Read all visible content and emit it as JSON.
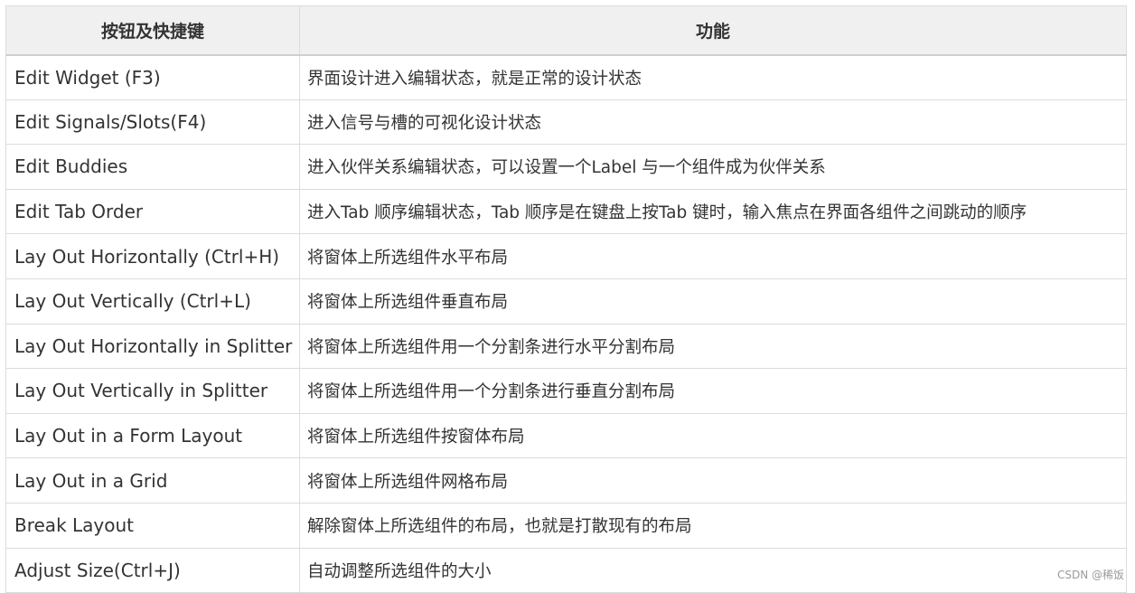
{
  "table": {
    "headers": [
      "按钮及快捷键",
      "功能"
    ],
    "rows": [
      {
        "key": "Edit Widget (F3)",
        "function": "界面设计进入编辑状态，就是正常的设计状态"
      },
      {
        "key": "Edit Signals/Slots(F4)",
        "function": "进入信号与槽的可视化设计状态"
      },
      {
        "key": "Edit Buddies",
        "function": "进入伙伴关系编辑状态，可以设置一个Label 与一个组件成为伙伴关系"
      },
      {
        "key": "Edit Tab Order",
        "function": "进入Tab 顺序编辑状态，Tab 顺序是在键盘上按Tab 键时，输入焦点在界面各组件之间跳动的顺序"
      },
      {
        "key": "Lay Out Horizontally (Ctrl+H)",
        "function": "将窗体上所选组件水平布局"
      },
      {
        "key": "Lay Out Vertically (Ctrl+L)",
        "function": "将窗体上所选组件垂直布局"
      },
      {
        "key": "Lay Out Horizontally in Splitter",
        "function": "将窗体上所选组件用一个分割条进行水平分割布局"
      },
      {
        "key": "Lay Out Vertically in Splitter",
        "function": "将窗体上所选组件用一个分割条进行垂直分割布局"
      },
      {
        "key": "Lay Out in a Form Layout",
        "function": "将窗体上所选组件按窗体布局"
      },
      {
        "key": "Lay Out in a Grid",
        "function": "将窗体上所选组件网格布局"
      },
      {
        "key": "Break Layout",
        "function": "解除窗体上所选组件的布局，也就是打散现有的布局"
      },
      {
        "key": "Adjust Size(Ctrl+J)",
        "function": "自动调整所选组件的大小"
      }
    ]
  },
  "watermark": "CSDN @稀饭"
}
